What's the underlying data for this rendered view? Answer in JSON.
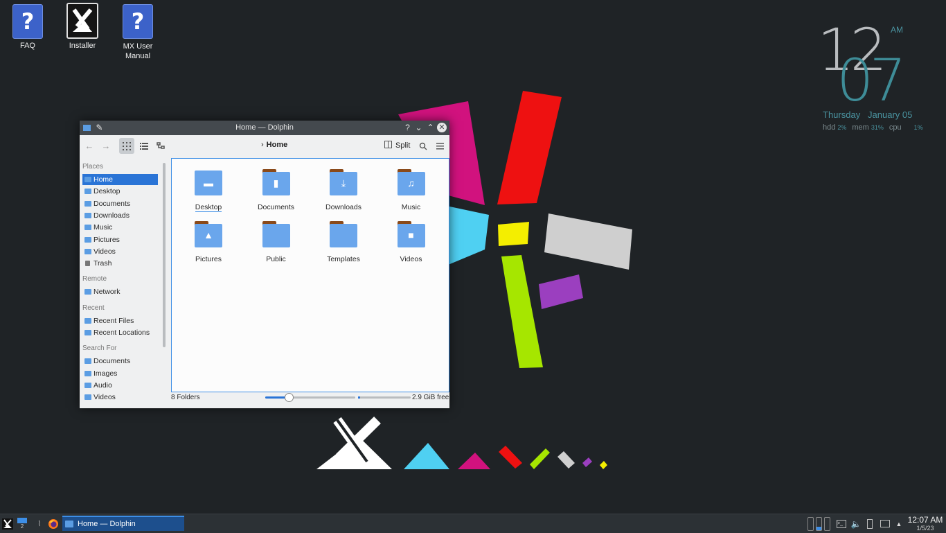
{
  "desktop": {
    "icons": [
      {
        "label": "FAQ"
      },
      {
        "label": "Installer"
      },
      {
        "label": "MX User Manual"
      }
    ]
  },
  "clock_widget": {
    "hour": "12",
    "minute": "07",
    "ampm": "AM",
    "day": "Thursday",
    "date": "January 05",
    "stats": [
      {
        "label": "hdd",
        "value": "2%"
      },
      {
        "label": "mem",
        "value": "31%"
      },
      {
        "label": "cpu",
        "value": "1%"
      }
    ]
  },
  "window": {
    "title": "Home — Dolphin",
    "breadcrumb": "Home",
    "split_label": "Split",
    "places": {
      "sections": [
        {
          "title": "Places",
          "items": [
            "Home",
            "Desktop",
            "Documents",
            "Downloads",
            "Music",
            "Pictures",
            "Videos",
            "Trash"
          ]
        },
        {
          "title": "Remote",
          "items": [
            "Network"
          ]
        },
        {
          "title": "Recent",
          "items": [
            "Recent Files",
            "Recent Locations"
          ]
        },
        {
          "title": "Search For",
          "items": [
            "Documents",
            "Images",
            "Audio",
            "Videos"
          ]
        }
      ],
      "selected": "Home"
    },
    "folders": [
      {
        "name": "Desktop",
        "emblem": "desktop"
      },
      {
        "name": "Documents",
        "emblem": "document"
      },
      {
        "name": "Downloads",
        "emblem": "download"
      },
      {
        "name": "Music",
        "emblem": "music"
      },
      {
        "name": "Pictures",
        "emblem": "picture"
      },
      {
        "name": "Public",
        "emblem": "none"
      },
      {
        "name": "Templates",
        "emblem": "none"
      },
      {
        "name": "Videos",
        "emblem": "video"
      }
    ],
    "status": {
      "count": "8 Folders",
      "free": "2.9 GiB free",
      "zoom_fraction": 0.26
    }
  },
  "panel": {
    "pager_desktop": "2",
    "task_label": "Home — Dolphin",
    "time": "12:07 AM",
    "date": "1/5/23"
  },
  "colors": {
    "accent": "#2a74d6",
    "folder": "#6aa6ec",
    "folder_tab": "#8a4a1a",
    "titlebar": "#44494e",
    "panel": "#2c3135",
    "clock_teal": "#3e8c97"
  }
}
